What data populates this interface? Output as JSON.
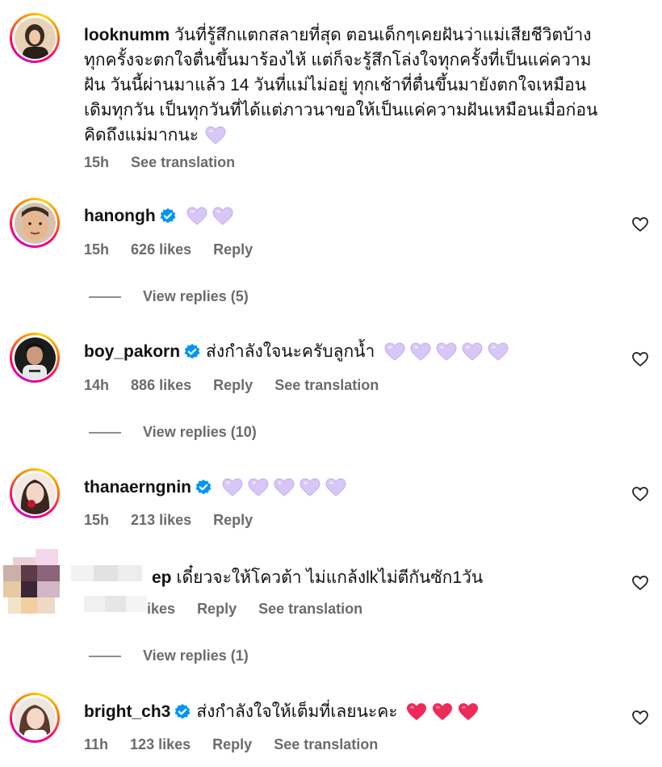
{
  "comments": [
    {
      "username": "looknumm",
      "text_lines": [
        "วันที่รู้สึกแตกสลายที่สุด ตอนเด็กๆเคยฝันว่าแม่เสียชีวิตบ้าง",
        "ทุกครั้งจะตกใจตื่นขึ้นมาร้องไห้ แต่ก็จะรู้สึกโล่งใจทุกครั้งที่เป็นแค่ความ",
        "ฝัน วันนี้ผ่านมาแล้ว 14 วันที่แม่ไม่อยู่ ทุกเช้าที่ตื่นขึ้นมายังตกใจเหมือน",
        "เดิมทุกวัน เป็นทุกวันที่ได้แต่ภาวนาขอให้เป็นแค่ความฝันเหมือนเมื่อก่อน",
        "คิดถึงแม่มากนะ"
      ],
      "time": "15h",
      "see_translation": "See translation",
      "emoji": "purple-heart"
    },
    {
      "username": "hanongh",
      "verified": true,
      "time": "15h",
      "likes": "626 likes",
      "reply": "Reply",
      "view_replies": "View replies (5)"
    },
    {
      "username": "boy_pakorn",
      "verified": true,
      "text": "ส่งกำลังใจนะครับลูกน้ำ",
      "time": "14h",
      "likes": "886 likes",
      "reply": "Reply",
      "see_translation": "See translation",
      "view_replies": "View replies (10)"
    },
    {
      "username": "thanaerngnin",
      "verified": true,
      "time": "15h",
      "likes": "213 likes",
      "reply": "Reply"
    },
    {
      "username_visible": "ep",
      "text": "เดี๋ยวจะให้โควต้า ไม่แกล้งlkไม่ตีกันซัก1วัน",
      "likes_partial": "ikes",
      "reply": "Reply",
      "see_translation": "See translation",
      "view_replies": "View replies (1)"
    },
    {
      "username": "bright_ch3",
      "verified": true,
      "text": "ส่งกำลังใจให้เต็มที่เลยนะคะ",
      "time": "11h",
      "likes": "123 likes",
      "reply": "Reply",
      "see_translation": "See translation"
    }
  ],
  "colors": {
    "meta_gray": "#6b6b6b",
    "verified_blue": "#0095f6",
    "purple_heart": "#d9c8f7",
    "red_heart": "#f0245a"
  },
  "icons": [
    "heart-outline-icon",
    "verified-badge-icon",
    "purple-heart-emoji",
    "red-heart-emoji"
  ]
}
